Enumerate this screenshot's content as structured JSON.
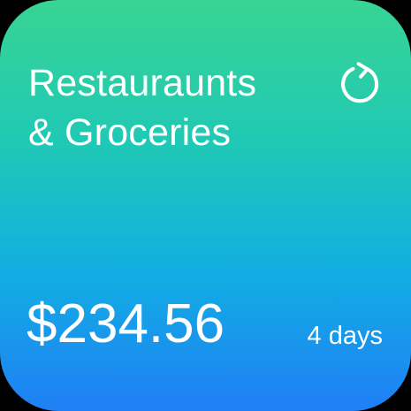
{
  "widget": {
    "title_line1": "Restauraunts",
    "title_line2": "& Groceries",
    "amount": "$234.56",
    "period": "4 days",
    "refresh_icon": "refresh-icon"
  },
  "colors": {
    "gradient_top": "#38d493",
    "gradient_mid": "#12aee2",
    "gradient_bottom": "#1f7ff6",
    "text": "#ffffff"
  }
}
